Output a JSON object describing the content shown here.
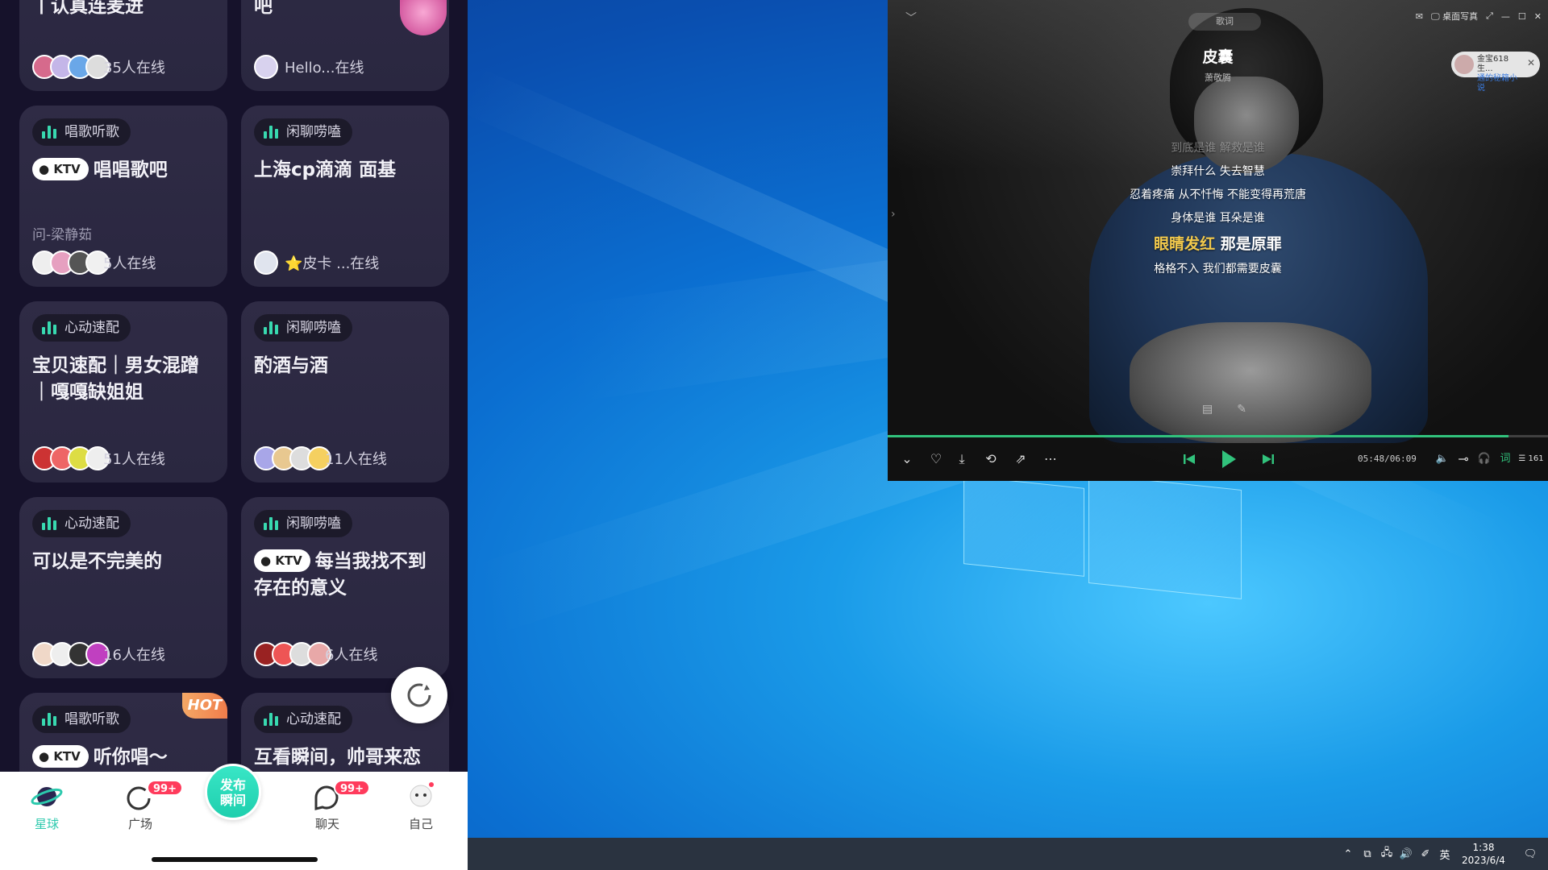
{
  "phone": {
    "cards": [
      {
        "title": "丨认真连麦进",
        "online": "35人在线",
        "tag": "",
        "ktv": false,
        "sub": ""
      },
      {
        "title": "吧",
        "online": "Hello...在线",
        "tag": "",
        "ktv": false,
        "sub": ""
      },
      {
        "tag": "唱歌听歌",
        "ktv": true,
        "ktv_label": "KTV",
        "title": "唱唱歌吧",
        "sub": "问-梁静茹",
        "online": "5人在线"
      },
      {
        "tag": "闲聊唠嗑",
        "ktv": false,
        "title": "上海cp滴滴 面基",
        "sub": "",
        "online": "⭐皮卡 ...在线"
      },
      {
        "tag": "心动速配",
        "ktv": false,
        "title": "宝贝速配｜男女混蹭｜嘎嘎缺姐姐",
        "sub": "",
        "online": "51人在线"
      },
      {
        "tag": "闲聊唠嗑",
        "ktv": false,
        "title": "酌酒与酒",
        "sub": "",
        "online": "11人在线"
      },
      {
        "tag": "心动速配",
        "ktv": false,
        "title": "可以是不完美的",
        "sub": "",
        "online": "16人在线"
      },
      {
        "tag": "闲聊唠嗑",
        "ktv": true,
        "ktv_label": "KTV",
        "title": "每当我找不到存在的意义",
        "sub": "",
        "online": "6人在线"
      },
      {
        "tag": "唱歌听歌",
        "ktv": true,
        "ktv_label": "KTV",
        "title": "听你唱～",
        "sub": "",
        "online": "",
        "hot": "HOT"
      },
      {
        "tag": "心动速配",
        "ktv": false,
        "title": "互看瞬间，帅哥来恋",
        "sub": "",
        "online": ""
      }
    ],
    "nav": {
      "planet": "星球",
      "square": "广场",
      "square_badge": "99+",
      "publish": "发布\n瞬间",
      "chat": "聊天",
      "chat_badge": "99+",
      "me": "自己"
    }
  },
  "player": {
    "song_title": "皮囊",
    "artist": "萧敬腾",
    "tabs_label": "歌词",
    "top_right_label": "桌面写真",
    "ad": {
      "line1": "金宝618生...",
      "line2": "通的秘籍小说"
    },
    "lyrics": [
      {
        "text": "到底是谁 解救是谁",
        "state": "dim"
      },
      {
        "text": "崇拜什么 失去智慧",
        "state": "normal"
      },
      {
        "text": "忍着疼痛 从不忏悔 不能变得再荒唐",
        "state": "normal"
      },
      {
        "text": "身体是谁 耳朵是谁",
        "state": "normal"
      },
      {
        "text_sung": "眼睛发红",
        "text_rest": " 那是原罪",
        "state": "current"
      },
      {
        "text": "格格不入 我们都需要皮囊",
        "state": "normal"
      }
    ],
    "time": "05:48/06:09",
    "progress": 0.94,
    "volume_label": "161"
  },
  "taskbar": {
    "ime": "英",
    "time": "1:38",
    "date": "2023/6/4"
  },
  "colors": {
    "accent_green": "#31c27c",
    "lyric_highlight": "#f2c94c",
    "teal": "#38d9b0",
    "badge_red": "#ff3b5c"
  }
}
